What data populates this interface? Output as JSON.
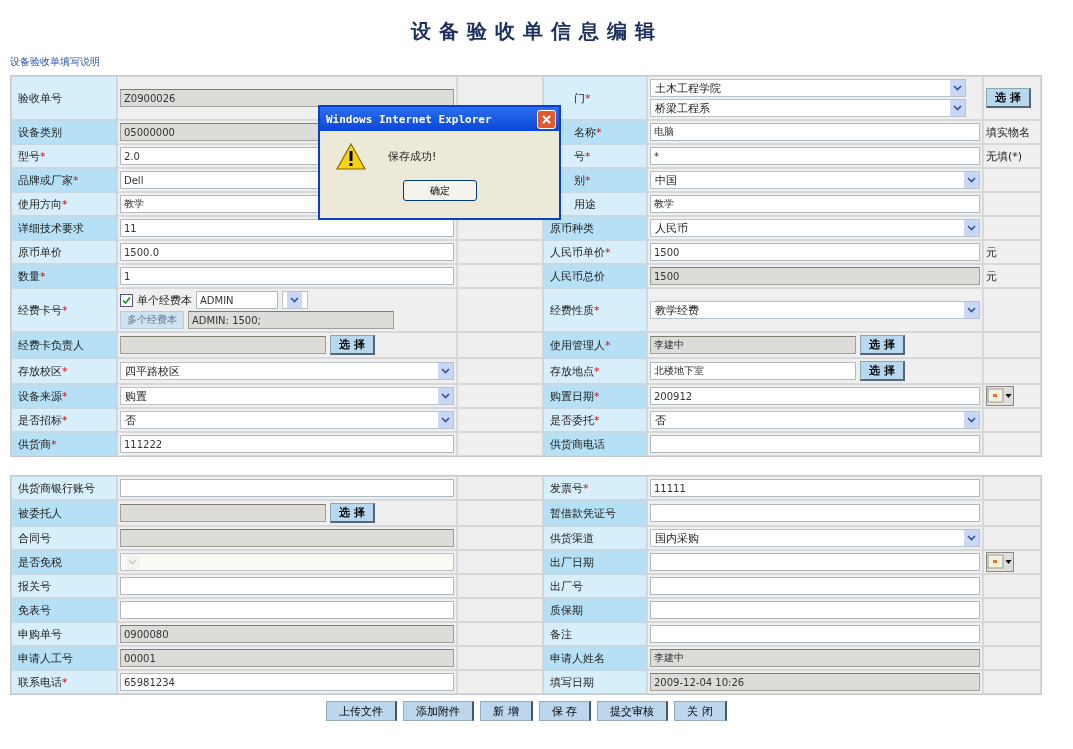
{
  "page_title": "设备验收单信息编辑",
  "help_link": "设备验收单填写说明",
  "sections": [
    {
      "rows": [
        {
          "cells": [
            {
              "label": "验收单号",
              "required": false,
              "field": {
                "kind": "readonly",
                "value": "Z0900026"
              }
            },
            {
              "label": "门",
              "required": true,
              "covered": true,
              "field": {
                "kind": "dual-select",
                "values": [
                  "土木工程学院",
                  "桥梁工程系"
                ]
              },
              "extra": {
                "kind": "button",
                "text": "选 择"
              }
            }
          ]
        },
        {
          "cells": [
            {
              "label": "设备类别",
              "required": false,
              "field": {
                "kind": "readonly",
                "value": "05000000"
              }
            },
            {
              "label": "名称",
              "required": true,
              "covered": true,
              "field": {
                "kind": "text",
                "value": "电脑"
              },
              "extra": {
                "kind": "note",
                "text": "填实物名"
              }
            }
          ]
        },
        {
          "cells": [
            {
              "label": "型号",
              "required": true,
              "field": {
                "kind": "text",
                "value": "2.0"
              }
            },
            {
              "label": "号",
              "required": true,
              "covered": true,
              "field": {
                "kind": "text",
                "value": "*"
              },
              "extra": {
                "kind": "note",
                "text": "无填(*)"
              }
            }
          ]
        },
        {
          "cells": [
            {
              "label": "品牌或厂家",
              "required": true,
              "field": {
                "kind": "text",
                "value": "Dell"
              }
            },
            {
              "label": "别",
              "required": true,
              "covered": true,
              "field": {
                "kind": "select",
                "value": "中国"
              }
            }
          ]
        },
        {
          "cells": [
            {
              "label": "使用方向",
              "required": true,
              "field": {
                "kind": "text",
                "value": "教学"
              }
            },
            {
              "label": "用途",
              "required": false,
              "covered": true,
              "field": {
                "kind": "text",
                "value": "教学"
              }
            }
          ]
        },
        {
          "cells": [
            {
              "label": "详细技术要求",
              "required": false,
              "field": {
                "kind": "text",
                "value": "11"
              }
            },
            {
              "label": "原币种类",
              "required": false,
              "field": {
                "kind": "select",
                "value": "人民币"
              }
            }
          ]
        },
        {
          "cells": [
            {
              "label": "原币单价",
              "required": false,
              "field": {
                "kind": "text",
                "value": "1500.0"
              }
            },
            {
              "label": "人民币单价",
              "required": true,
              "field": {
                "kind": "text",
                "value": "1500"
              },
              "extra": {
                "kind": "note",
                "text": "元"
              }
            }
          ]
        },
        {
          "cells": [
            {
              "label": "数量",
              "required": true,
              "field": {
                "kind": "text",
                "value": "1"
              }
            },
            {
              "label": "人民币总价",
              "required": false,
              "field": {
                "kind": "readonly",
                "value": "1500"
              },
              "extra": {
                "kind": "note",
                "text": "元"
              }
            }
          ]
        },
        {
          "cells": [
            {
              "label": "经费卡号",
              "required": true,
              "field": {
                "kind": "card",
                "checked": true,
                "check_label": "单个经费本",
                "value": "ADMIN",
                "button": "多个经费本",
                "summary": "ADMIN: 1500;"
              }
            },
            {
              "label": "经费性质",
              "required": true,
              "field": {
                "kind": "select",
                "value": "教学经费"
              }
            }
          ]
        },
        {
          "cells": [
            {
              "label": "经费卡负责人",
              "required": false,
              "field": {
                "kind": "pick",
                "readonly": true,
                "button": "选 择"
              }
            },
            {
              "label": "使用管理人",
              "required": true,
              "field": {
                "kind": "pick",
                "readonly": true,
                "value": "李建中",
                "button": "选 择"
              }
            }
          ]
        },
        {
          "cells": [
            {
              "label": "存放校区",
              "required": true,
              "field": {
                "kind": "select",
                "value": "四平路校区"
              }
            },
            {
              "label": "存放地点",
              "required": true,
              "field": {
                "kind": "pick",
                "readonly": false,
                "value": "北楼地下室",
                "button": "选 择"
              }
            }
          ]
        },
        {
          "cells": [
            {
              "label": "设备来源",
              "required": true,
              "field": {
                "kind": "select",
                "value": "购置"
              }
            },
            {
              "label": "购置日期",
              "required": true,
              "field": {
                "kind": "text",
                "value": "200912"
              },
              "extra": {
                "kind": "calendar"
              }
            }
          ]
        },
        {
          "cells": [
            {
              "label": "是否招标",
              "required": true,
              "field": {
                "kind": "select",
                "value": "否"
              }
            },
            {
              "label": "是否委托",
              "required": true,
              "field": {
                "kind": "select",
                "value": "否"
              }
            }
          ]
        },
        {
          "cells": [
            {
              "label": "供货商",
              "required": true,
              "field": {
                "kind": "text",
                "value": "111222"
              }
            },
            {
              "label": "供货商电话",
              "required": false,
              "field": {
                "kind": "text"
              }
            }
          ]
        }
      ]
    },
    {
      "rows": [
        {
          "cells": [
            {
              "label": "供货商银行账号",
              "required": false,
              "field": {
                "kind": "text"
              }
            },
            {
              "label": "发票号",
              "required": true,
              "field": {
                "kind": "text",
                "value": "11111"
              }
            }
          ]
        },
        {
          "cells": [
            {
              "label": "被委托人",
              "required": false,
              "field": {
                "kind": "pick",
                "readonly": true,
                "button": "选 择"
              }
            },
            {
              "label": "暂借款凭证号",
              "required": false,
              "field": {
                "kind": "text"
              }
            }
          ]
        },
        {
          "cells": [
            {
              "label": "合同号",
              "required": false,
              "field": {
                "kind": "readonly"
              }
            },
            {
              "label": "供货渠道",
              "required": false,
              "field": {
                "kind": "select",
                "value": "国内采购"
              }
            }
          ]
        },
        {
          "cells": [
            {
              "label": "是否免税",
              "required": false,
              "field": {
                "kind": "select-disabled"
              }
            },
            {
              "label": "出厂日期",
              "required": false,
              "field": {
                "kind": "text"
              },
              "extra": {
                "kind": "calendar"
              }
            }
          ]
        },
        {
          "cells": [
            {
              "label": "报关号",
              "required": false,
              "field": {
                "kind": "text"
              }
            },
            {
              "label": "出厂号",
              "required": false,
              "field": {
                "kind": "text"
              }
            }
          ]
        },
        {
          "cells": [
            {
              "label": "免表号",
              "required": false,
              "field": {
                "kind": "text"
              }
            },
            {
              "label": "质保期",
              "required": false,
              "field": {
                "kind": "text"
              }
            }
          ]
        },
        {
          "cells": [
            {
              "label": "申购单号",
              "required": false,
              "field": {
                "kind": "readonly",
                "value": "0900080"
              }
            },
            {
              "label": "备注",
              "required": false,
              "field": {
                "kind": "text"
              }
            }
          ]
        },
        {
          "cells": [
            {
              "label": "申请人工号",
              "required": false,
              "field": {
                "kind": "readonly",
                "value": "00001"
              }
            },
            {
              "label": "申请人姓名",
              "required": false,
              "field": {
                "kind": "readonly",
                "value": "李建中"
              }
            }
          ]
        },
        {
          "cells": [
            {
              "label": "联系电话",
              "required": true,
              "field": {
                "kind": "text",
                "value": "65981234"
              }
            },
            {
              "label": "填写日期",
              "required": false,
              "field": {
                "kind": "readonly",
                "value": "2009-12-04 10:26"
              }
            }
          ]
        }
      ]
    }
  ],
  "buttons": [
    "上传文件",
    "添加附件",
    "新 增",
    "保 存",
    "提交审核",
    "关 闭"
  ],
  "dialog": {
    "title": "Windows Internet Explorer",
    "message": "保存成功!",
    "button": "确定"
  }
}
